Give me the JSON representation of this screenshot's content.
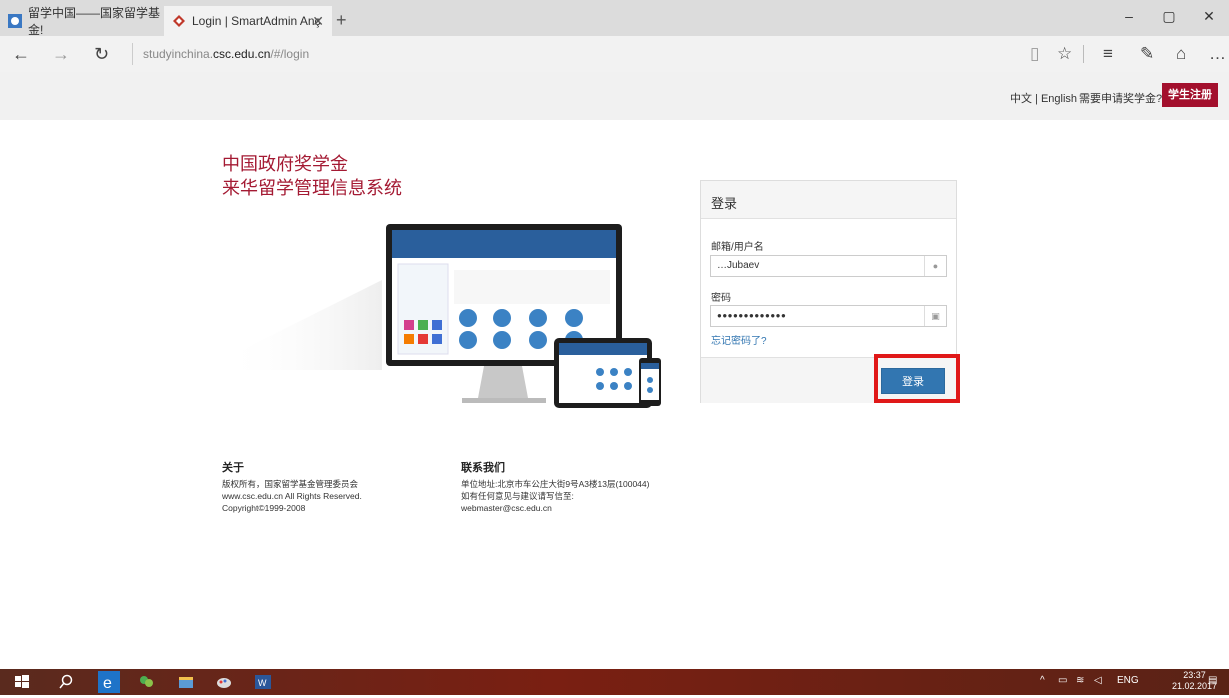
{
  "browser": {
    "tabs": [
      {
        "title": "留学中国——国家留学基金!",
        "active": false
      },
      {
        "title": "Login | SmartAdmin Anç",
        "active": true
      }
    ],
    "new_tab": "+",
    "window_buttons": [
      "–",
      "▢",
      "✕"
    ],
    "url_prefix": "studyinchina.",
    "url_domain": "csc.edu.cn",
    "url_path": "/#/login",
    "nav": {
      "back": "←",
      "forward": "→",
      "refresh": "↻"
    },
    "tools": [
      "reading-view-icon",
      "favorite-star-icon",
      "hub-icon",
      "web-note-icon",
      "share-icon",
      "more-icon"
    ]
  },
  "header": {
    "lang": "中文 | English",
    "apply": "需要申请奖学金?",
    "register": "学生注册"
  },
  "titles": {
    "line1": "中国政府奖学金",
    "line2": "来华留学管理信息系统"
  },
  "login": {
    "heading": "登录",
    "username_label": "邮箱/用户名",
    "username_value": "…Jubaev",
    "password_label": "密码",
    "password_value": "●●●●●●●●●●●●●",
    "forgot": "忘记密码了?",
    "submit": "登录"
  },
  "footer": {
    "about_heading": "关于",
    "about_lines": [
      "版权所有，国家留学基金管理委员会",
      "www.csc.edu.cn All Rights Reserved.",
      "Copyright©1999-2008"
    ],
    "contact_heading": "联系我们",
    "contact_lines": [
      "单位地址:北京市车公庄大街9号A3楼13层(100044)",
      "如有任何意见与建议请写信至:",
      "webmaster@csc.edu.cn"
    ]
  },
  "taskbar": {
    "lang": "ENG",
    "time": "23:37",
    "date": "21.02.2017"
  },
  "colors": {
    "brand_red": "#a3102d",
    "title_red": "#a41a33",
    "button_blue": "#3276b1",
    "highlight_red": "#e01818"
  }
}
